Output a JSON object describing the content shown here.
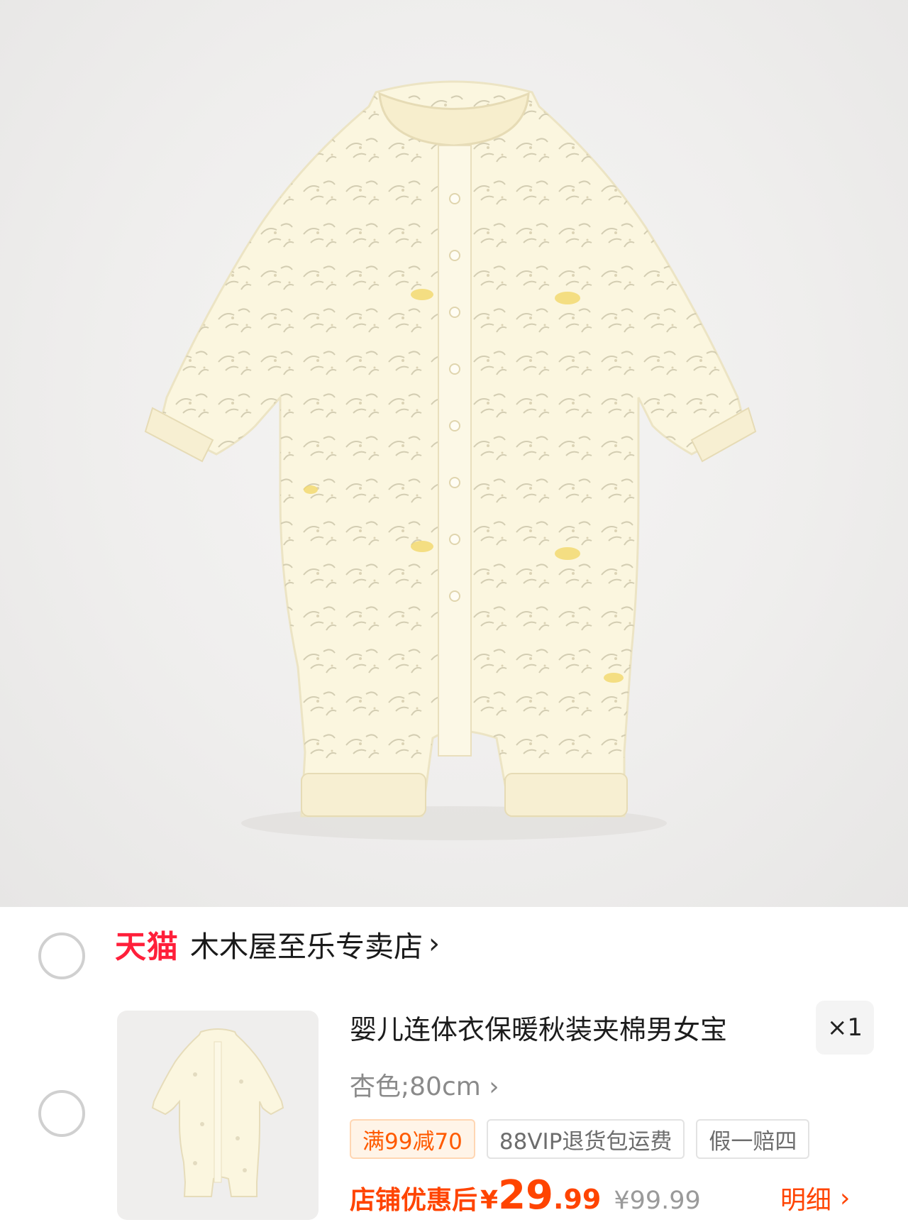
{
  "store": {
    "platform_label": "天猫",
    "name": "木木屋至乐专卖店",
    "chevron": "›"
  },
  "item": {
    "title": "婴儿连体衣保暖秋装夹棉男女宝",
    "quantity": "×1",
    "spec": "杏色;80cm ›",
    "tags": [
      "满99减70",
      "88VIP退货包运费",
      "假一赔四"
    ],
    "price_label": "店铺优惠后",
    "currency": "¥",
    "price_int": "29",
    "price_dec": ".99",
    "original_price": "¥99.99",
    "detail_label": "明细",
    "detail_chevron": "›"
  },
  "colors": {
    "tmall_red": "#ff1f3a",
    "price_orange": "#ff4400",
    "garment_cream": "#fbf6df"
  }
}
